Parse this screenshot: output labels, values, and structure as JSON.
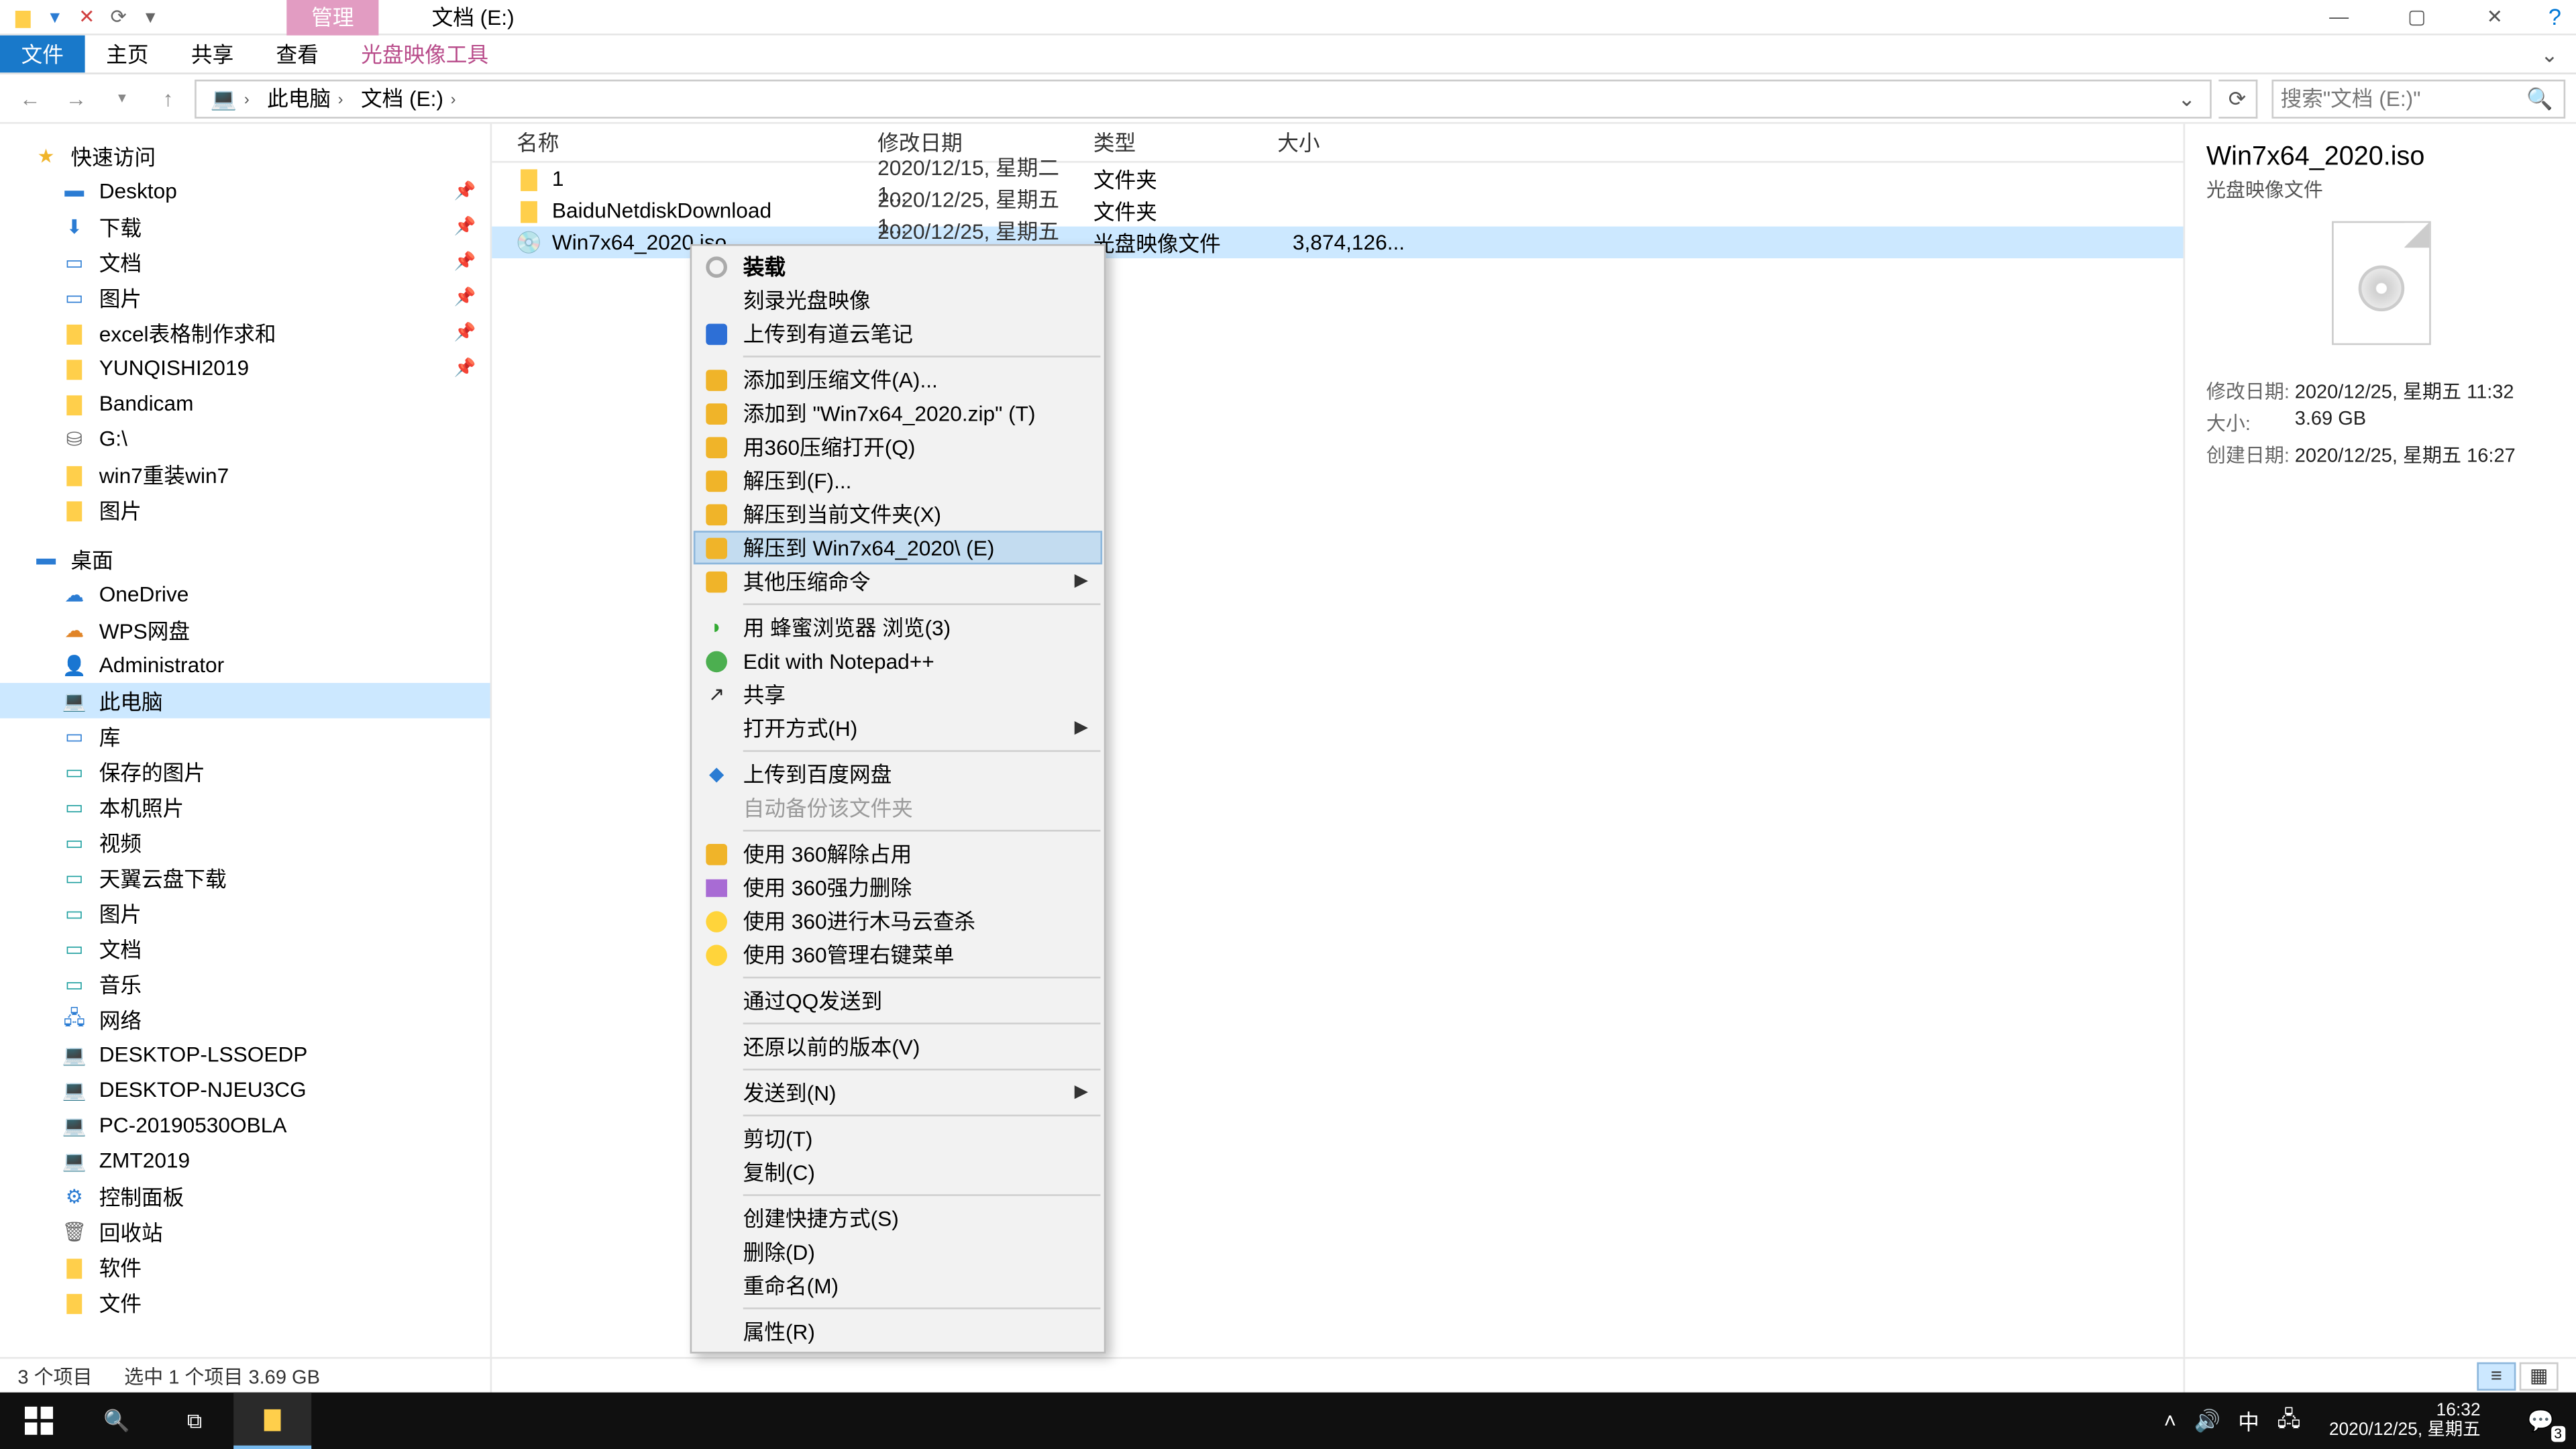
{
  "window": {
    "context_tab": "管理",
    "location_title": "文档 (E:)",
    "ribbon": {
      "file": "文件",
      "home": "主页",
      "share": "共享",
      "view": "查看",
      "tool": "光盘映像工具"
    }
  },
  "breadcrumb": {
    "root": "此电脑",
    "item": "文档 (E:)"
  },
  "search_placeholder": "搜索\"文档 (E:)\"",
  "columns": {
    "name": "名称",
    "modified": "修改日期",
    "type": "类型",
    "size": "大小"
  },
  "tree": {
    "quick": "快速访问",
    "items1": [
      "Desktop",
      "下载",
      "文档",
      "图片",
      "excel表格制作求和",
      "YUNQISHI2019",
      "Bandicam",
      "G:\\",
      "win7重装win7",
      "图片"
    ],
    "desktop": "桌面",
    "items2": [
      "OneDrive",
      "WPS网盘",
      "Administrator",
      "此电脑",
      "库"
    ],
    "lib": [
      "保存的图片",
      "本机照片",
      "视频",
      "天翼云盘下载",
      "图片",
      "文档",
      "音乐"
    ],
    "network": "网络",
    "net": [
      "DESKTOP-LSSOEDP",
      "DESKTOP-NJEU3CG",
      "PC-20190530OBLA",
      "ZMT2019"
    ],
    "misc": [
      "控制面板",
      "回收站",
      "软件",
      "文件"
    ]
  },
  "rows": [
    {
      "name": "1",
      "mod": "2020/12/15, 星期二 1...",
      "type": "文件夹",
      "size": ""
    },
    {
      "name": "BaiduNetdiskDownload",
      "mod": "2020/12/25, 星期五 1...",
      "type": "文件夹",
      "size": ""
    },
    {
      "name": "Win7x64_2020.iso",
      "mod": "2020/12/25, 星期五 1...",
      "type": "光盘映像文件",
      "size": "3,874,126..."
    }
  ],
  "context_menu": [
    {
      "label": "装载",
      "icon": "disc",
      "bold": true
    },
    {
      "label": "刻录光盘映像"
    },
    {
      "label": "上传到有道云笔记",
      "icon": "blue"
    },
    {
      "sep": true
    },
    {
      "label": "添加到压缩文件(A)...",
      "icon": "box"
    },
    {
      "label": "添加到 \"Win7x64_2020.zip\" (T)",
      "icon": "box"
    },
    {
      "label": "用360压缩打开(Q)",
      "icon": "box"
    },
    {
      "label": "解压到(F)...",
      "icon": "box"
    },
    {
      "label": "解压到当前文件夹(X)",
      "icon": "box"
    },
    {
      "label": "解压到 Win7x64_2020\\ (E)",
      "icon": "box",
      "hover": true
    },
    {
      "label": "其他压缩命令",
      "icon": "box",
      "sub": true
    },
    {
      "sep": true
    },
    {
      "label": "用 蜂蜜浏览器 浏览(3)",
      "icon": "greenDot"
    },
    {
      "label": "Edit with Notepad++",
      "icon": "green"
    },
    {
      "label": "共享",
      "icon": "share"
    },
    {
      "label": "打开方式(H)",
      "sub": true
    },
    {
      "sep": true
    },
    {
      "label": "上传到百度网盘",
      "icon": "blueDot"
    },
    {
      "label": "自动备份该文件夹",
      "disabled": true
    },
    {
      "sep": true
    },
    {
      "label": "使用 360解除占用",
      "icon": "box"
    },
    {
      "label": "使用 360强力删除",
      "icon": "purple"
    },
    {
      "label": "使用 360进行木马云查杀",
      "icon": "yellow"
    },
    {
      "label": "使用 360管理右键菜单",
      "icon": "yellow"
    },
    {
      "sep": true
    },
    {
      "label": "通过QQ发送到"
    },
    {
      "sep": true
    },
    {
      "label": "还原以前的版本(V)"
    },
    {
      "sep": true
    },
    {
      "label": "发送到(N)",
      "sub": true
    },
    {
      "sep": true
    },
    {
      "label": "剪切(T)"
    },
    {
      "label": "复制(C)"
    },
    {
      "sep": true
    },
    {
      "label": "创建快捷方式(S)"
    },
    {
      "label": "删除(D)"
    },
    {
      "label": "重命名(M)"
    },
    {
      "sep": true
    },
    {
      "label": "属性(R)"
    }
  ],
  "details": {
    "name": "Win7x64_2020.iso",
    "type": "光盘映像文件",
    "mod_k": "修改日期:",
    "mod_v": "2020/12/25, 星期五 11:32",
    "size_k": "大小:",
    "size_v": "3.69 GB",
    "create_k": "创建日期:",
    "create_v": "2020/12/25, 星期五 16:27"
  },
  "status": {
    "count": "3 个项目",
    "sel": "选中 1 个项目  3.69 GB"
  },
  "tray": {
    "ime": "中",
    "time": "16:32",
    "date": "2020/12/25, 星期五",
    "badge": "3"
  }
}
